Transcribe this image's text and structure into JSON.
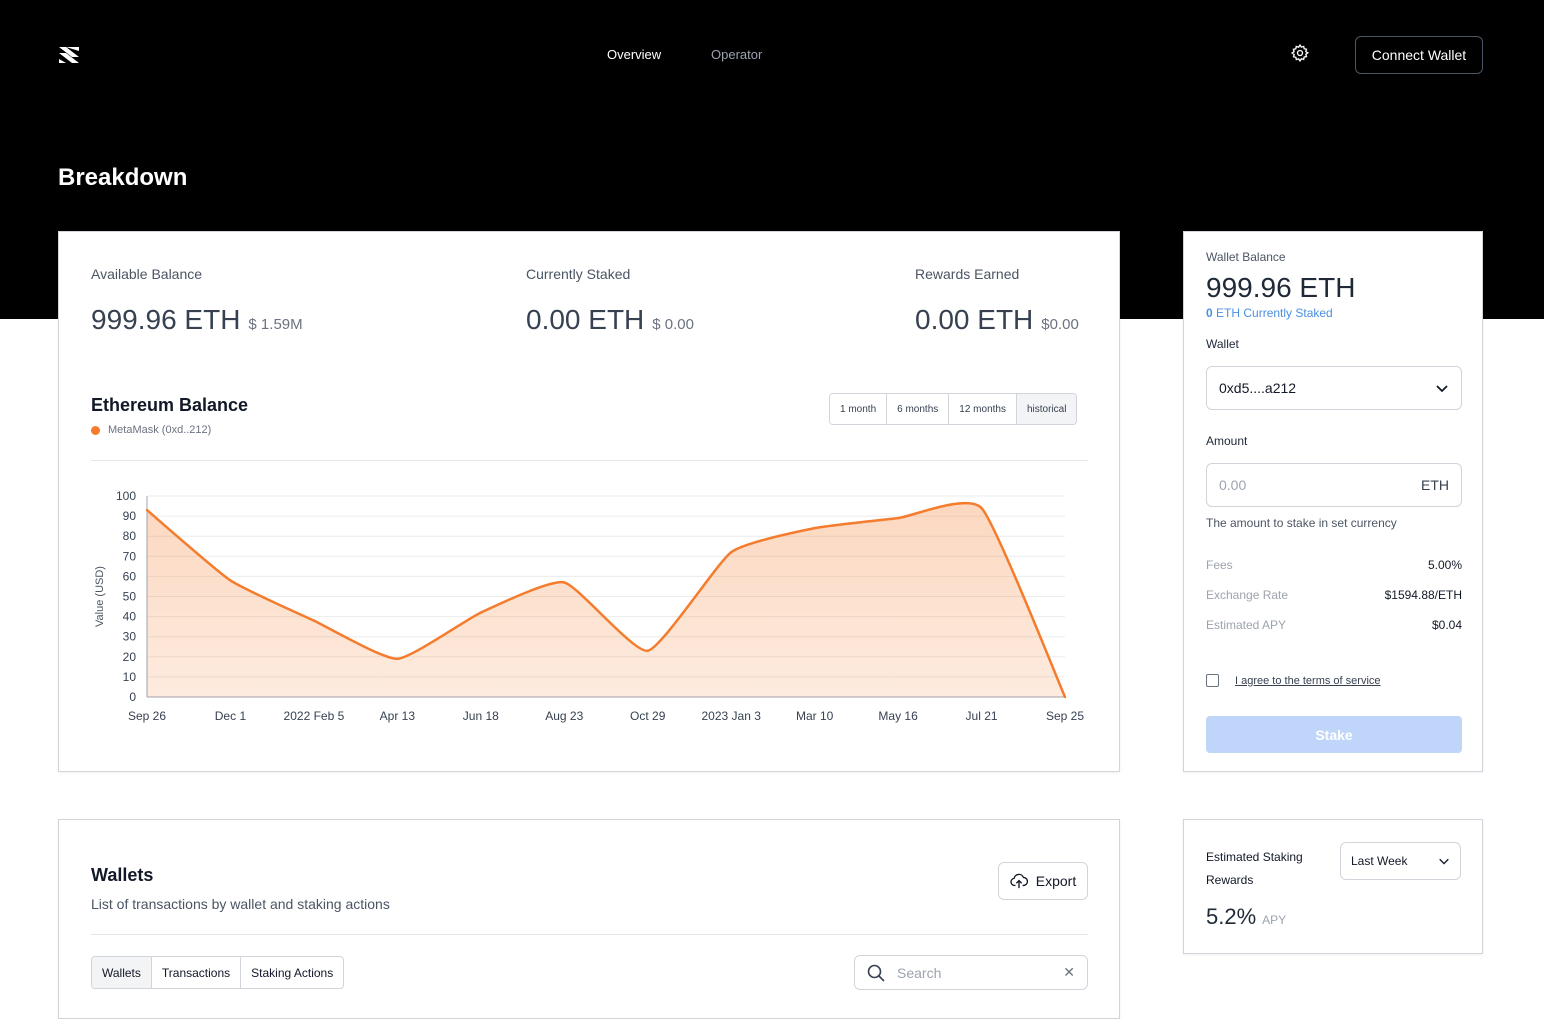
{
  "nav": {
    "overview": "Overview",
    "operator": "Operator",
    "connect": "Connect Wallet"
  },
  "page": {
    "title": "Breakdown"
  },
  "stats": [
    {
      "label": "Available Balance",
      "value": "999.96 ETH",
      "usd": "$ 1.59M"
    },
    {
      "label": "Currently Staked",
      "value": "0.00 ETH",
      "usd": "$ 0.00"
    },
    {
      "label": "Rewards Earned",
      "value": "0.00 ETH",
      "usd": "$0.00"
    }
  ],
  "chart": {
    "title": "Ethereum Balance",
    "legend": "MetaMask (0xd..212)",
    "ranges": [
      "1 month",
      "6 months",
      "12 months",
      "historical"
    ],
    "active_range": "historical",
    "color": "#f47c2c"
  },
  "chart_data": {
    "type": "area",
    "title": "Ethereum Balance",
    "ylabel": "Value (USD)",
    "xlabel": "",
    "ylim": [
      0,
      100
    ],
    "yticks": [
      0,
      10,
      20,
      30,
      40,
      50,
      60,
      70,
      80,
      90,
      100
    ],
    "grid": true,
    "x": [
      "Sep 26",
      "Dec 1",
      "2022 Feb 5",
      "Apr 13",
      "Jun 18",
      "Aug 23",
      "Oct 29",
      "2023 Jan 3",
      "Mar 10",
      "May 16",
      "Jul 21",
      "Sep 25"
    ],
    "series": [
      {
        "name": "MetaMask (0xd..212)",
        "values": [
          93,
          58,
          38,
          19,
          42,
          57,
          23,
          72,
          84,
          89,
          94,
          0
        ]
      }
    ]
  },
  "side": {
    "wallet_balance_label": "Wallet Balance",
    "wallet_balance": "999.96 ETH",
    "staked_count": "0",
    "staked_text": " ETH Currently Staked",
    "wallet_label": "Wallet",
    "wallet_value": "0xd5....a212",
    "amount_label": "Amount",
    "amount_placeholder": "0.00",
    "amount_unit": "ETH",
    "amount_help": "The amount to stake in set currency",
    "fees_label": "Fees",
    "fees": "5.00%",
    "rate_label": "Exchange Rate",
    "rate": "$1594.88/ETH",
    "apy_label": "Estimated APY",
    "apy": "$0.04",
    "terms": "I agree to the terms of service",
    "stake": "Stake"
  },
  "wallets": {
    "title": "Wallets",
    "subtitle": "List of transactions by wallet and staking actions",
    "export": "Export",
    "tabs": [
      "Wallets",
      "Transactions",
      "Staking Actions"
    ],
    "search_placeholder": "Search"
  },
  "rewards": {
    "label": "Estimated Staking Rewards",
    "period": "Last Week",
    "value": "5.2%",
    "unit": "APY"
  }
}
